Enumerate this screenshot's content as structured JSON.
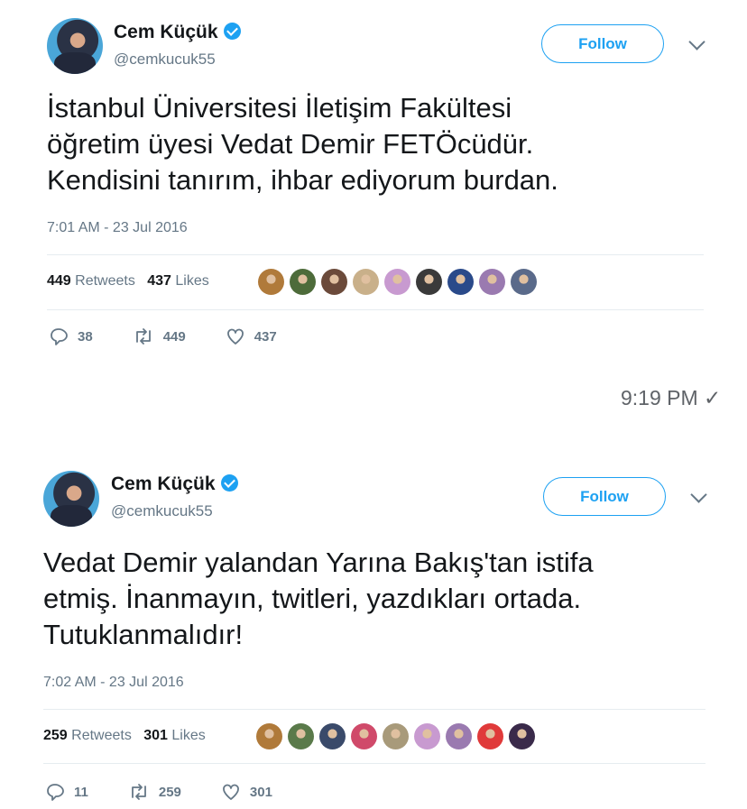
{
  "tweets": [
    {
      "author_name": "Cem Küçük",
      "handle": "@cemkucuk55",
      "follow_label": "Follow",
      "text_lines": [
        "İstanbul Üniversitesi İletişim Fakültesi",
        "öğretim üyesi Vedat Demir FETÖcüdür.",
        "Kendisini tanırım, ihbar ediyorum burdan."
      ],
      "time": "7:01 AM - 23 Jul 2016",
      "retweets_count": "449",
      "retweets_label": "Retweets",
      "likes_count": "437",
      "likes_label": "Likes",
      "liker_colors": [
        "#b07a3a",
        "#4d6b3a",
        "#6b4a3a",
        "#c9b08a",
        "#c89ad0",
        "#3a3a3a",
        "#2a4a8a",
        "#9a7ab0",
        "#5a6a8a"
      ],
      "replies": "38",
      "retweets": "449",
      "likes": "437"
    },
    {
      "author_name": "Cem Küçük",
      "handle": "@cemkucuk55",
      "follow_label": "Follow",
      "text_lines": [
        "Vedat Demir yalandan Yarına Bakış'tan istifa",
        "etmiş. İnanmayın, twitleri, yazdıkları ortada.",
        "Tutuklanmalıdır!"
      ],
      "time": "7:02 AM - 23 Jul 2016",
      "retweets_count": "259",
      "retweets_label": "Retweets",
      "likes_count": "301",
      "likes_label": "Likes",
      "liker_colors": [
        "#b07a3a",
        "#5a7a4a",
        "#3a4a6a",
        "#d04a6a",
        "#a89a7a",
        "#c89ad0",
        "#9a7ab0",
        "#e03a3a",
        "#3a2a4a"
      ],
      "replies": "11",
      "retweets": "259",
      "likes": "301"
    }
  ],
  "message_timestamp": "9:19 PM ✓"
}
